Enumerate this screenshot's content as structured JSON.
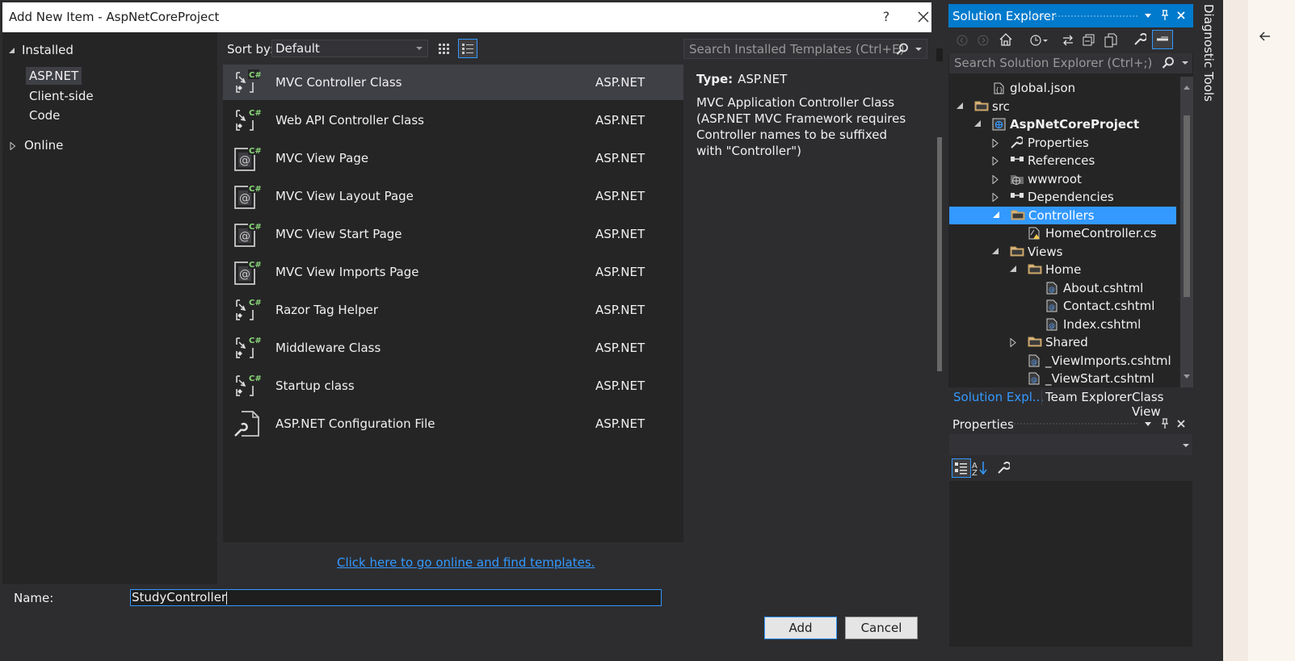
{
  "dialog": {
    "title": "Add New Item - AspNetCoreProject",
    "help_label": "?",
    "left": {
      "installed": "Installed",
      "categories": [
        "ASP.NET",
        "Client-side",
        "Code"
      ],
      "online": "Online"
    },
    "toolbar": {
      "sort_label": "Sort by:",
      "sort_value": "Default",
      "search_placeholder": "Search Installed Templates (Ctrl+E)"
    },
    "items": [
      {
        "name": "MVC Controller Class",
        "category": "ASP.NET",
        "icon": "csharp-class-icon",
        "selected": true
      },
      {
        "name": "Web API Controller Class",
        "category": "ASP.NET",
        "icon": "csharp-class-icon"
      },
      {
        "name": "MVC View Page",
        "category": "ASP.NET",
        "icon": "razor-view-icon"
      },
      {
        "name": "MVC View Layout Page",
        "category": "ASP.NET",
        "icon": "razor-view-icon"
      },
      {
        "name": "MVC View Start Page",
        "category": "ASP.NET",
        "icon": "razor-view-icon"
      },
      {
        "name": "MVC View Imports Page",
        "category": "ASP.NET",
        "icon": "razor-view-icon"
      },
      {
        "name": "Razor Tag Helper",
        "category": "ASP.NET",
        "icon": "csharp-class-icon"
      },
      {
        "name": "Middleware Class",
        "category": "ASP.NET",
        "icon": "csharp-class-icon"
      },
      {
        "name": "Startup class",
        "category": "ASP.NET",
        "icon": "csharp-class-icon"
      },
      {
        "name": "ASP.NET Configuration File",
        "category": "ASP.NET",
        "icon": "config-file-icon"
      }
    ],
    "details": {
      "type_label": "Type:",
      "type_value": "ASP.NET",
      "description": "MVC Application Controller Class (ASP.NET MVC Framework requires Controller names to be suffixed with \"Controller\")"
    },
    "online_link": "Click here to go online and find templates.",
    "name_label": "Name:",
    "name_value": "StudyController",
    "add_label": "Add",
    "cancel_label": "Cancel"
  },
  "solution_explorer": {
    "title": "Solution Explorer",
    "search_placeholder": "Search Solution Explorer (Ctrl+;)",
    "tree": [
      {
        "label": "global.json",
        "depth": 1,
        "expand": "",
        "icon": "json-file-icon"
      },
      {
        "label": "src",
        "depth": 0,
        "expand": "open",
        "icon": "folder-icon"
      },
      {
        "label": "AspNetCoreProject",
        "depth": 1,
        "expand": "open",
        "icon": "web-project-icon",
        "bold": true
      },
      {
        "label": "Properties",
        "depth": 2,
        "expand": "closed",
        "icon": "wrench-icon"
      },
      {
        "label": "References",
        "depth": 2,
        "expand": "closed",
        "icon": "references-icon"
      },
      {
        "label": "wwwroot",
        "depth": 2,
        "expand": "closed",
        "icon": "globe-folder-icon"
      },
      {
        "label": "Dependencies",
        "depth": 2,
        "expand": "closed",
        "icon": "references-icon"
      },
      {
        "label": "Controllers",
        "depth": 2,
        "expand": "open",
        "icon": "folder-icon",
        "selected": true
      },
      {
        "label": "HomeController.cs",
        "depth": 3,
        "expand": "",
        "icon": "cs-file-icon"
      },
      {
        "label": "Views",
        "depth": 2,
        "expand": "open",
        "icon": "folder-icon"
      },
      {
        "label": "Home",
        "depth": 3,
        "expand": "open",
        "icon": "folder-icon"
      },
      {
        "label": "About.cshtml",
        "depth": 4,
        "expand": "",
        "icon": "cshtml-file-icon"
      },
      {
        "label": "Contact.cshtml",
        "depth": 4,
        "expand": "",
        "icon": "cshtml-file-icon"
      },
      {
        "label": "Index.cshtml",
        "depth": 4,
        "expand": "",
        "icon": "cshtml-file-icon"
      },
      {
        "label": "Shared",
        "depth": 3,
        "expand": "closed",
        "icon": "folder-icon"
      },
      {
        "label": "_ViewImports.cshtml",
        "depth": 3,
        "expand": "",
        "icon": "cshtml-file-icon"
      },
      {
        "label": "_ViewStart.cshtml",
        "depth": 3,
        "expand": "",
        "icon": "cshtml-file-icon"
      }
    ],
    "tabs": [
      "Solution Expl...",
      "Team Explorer",
      "Class View"
    ]
  },
  "properties": {
    "title": "Properties"
  },
  "diagnostic": {
    "title": "Diagnostic Tools"
  },
  "colors": {
    "accent": "#007acc",
    "selection": "#3399ff",
    "link": "#3399ff",
    "background": "#2d2d30",
    "panel": "#252526"
  }
}
